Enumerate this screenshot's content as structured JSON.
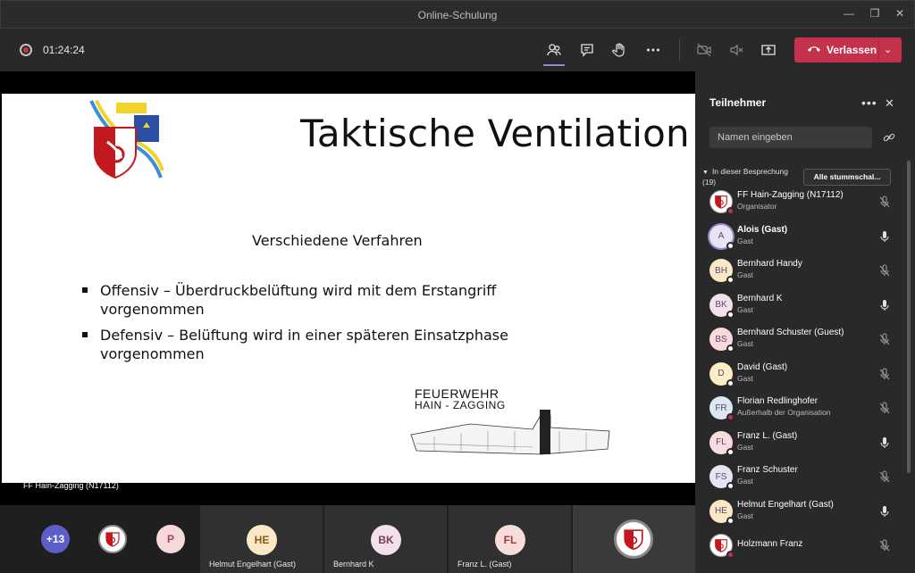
{
  "window": {
    "title": "Online-Schulung"
  },
  "toolbar": {
    "timer": "01:24:24",
    "leave_label": "Verlassen"
  },
  "slide": {
    "title": "Taktische Ventilation",
    "subtitle": "Verschiedene Verfahren",
    "bullets": [
      "Offensiv – Überdruckbelüftung wird mit dem Erstangriff vorgenommen",
      "Defensiv – Belüftung wird in einer späteren Einsatzphase vorgenommen"
    ],
    "logo_text_1": "FEUERWEHR",
    "logo_text_2": "HAIN - ZAGGING"
  },
  "stage": {
    "presenter_label": "FF Hain-Zagging (N17112)"
  },
  "strip": {
    "overflow": "+13",
    "tiles": [
      {
        "initials": "P",
        "name": ""
      },
      {
        "initials": "HE",
        "name": "Helmut Engelhart (Gast)"
      },
      {
        "initials": "BK",
        "name": "Bernhard K"
      },
      {
        "initials": "FL",
        "name": "Franz L. (Gast)"
      }
    ]
  },
  "panel": {
    "title": "Teilnehmer",
    "search_placeholder": "Namen eingeben",
    "section_label": "In dieser Besprechung (19)",
    "mute_all": "Alle stummschal...",
    "participants": [
      {
        "initials": "",
        "name": "FF Hain-Zagging (N17112)",
        "role": "Organisator",
        "avatar": "logo",
        "status": "red",
        "mic": "muted",
        "bold": false
      },
      {
        "initials": "A",
        "name": "Alois (Gast)",
        "role": "Gast",
        "avatar": "#e9e4f5",
        "status": "white",
        "mic": "on",
        "bold": true
      },
      {
        "initials": "BH",
        "name": "Bernhard Handy",
        "role": "Gast",
        "avatar": "#fbe8c7",
        "status": "white",
        "mic": "muted",
        "bold": false
      },
      {
        "initials": "BK",
        "name": "Bernhard K",
        "role": "Gast",
        "avatar": "#f2e0ea",
        "status": "white",
        "mic": "on",
        "bold": false
      },
      {
        "initials": "BS",
        "name": "Bernhard Schuster (Guest)",
        "role": "Gast",
        "avatar": "#f9d9d9",
        "status": "white",
        "mic": "muted",
        "bold": false
      },
      {
        "initials": "D",
        "name": "David (Gast)",
        "role": "Gast",
        "avatar": "#fbedc4",
        "status": "white",
        "mic": "muted",
        "bold": false
      },
      {
        "initials": "FR",
        "name": "Florian Redlinghofer",
        "role": "Außerhalb der Organisation",
        "avatar": "#dde7f1",
        "status": "red",
        "mic": "muted",
        "bold": false
      },
      {
        "initials": "FL",
        "name": "Franz L. (Gast)",
        "role": "Gast",
        "avatar": "#f7dcdc",
        "status": "white",
        "mic": "on",
        "bold": false
      },
      {
        "initials": "FS",
        "name": "Franz Schuster",
        "role": "Gast",
        "avatar": "#e4e4f4",
        "status": "white",
        "mic": "muted",
        "bold": false
      },
      {
        "initials": "HE",
        "name": "Helmut Engelhart (Gast)",
        "role": "Gast",
        "avatar": "#fbe8c7",
        "status": "white",
        "mic": "on",
        "bold": false
      },
      {
        "initials": "",
        "name": "Holzmann Franz",
        "role": "",
        "avatar": "logo",
        "status": "red",
        "mic": "muted",
        "bold": false
      }
    ]
  },
  "colors": {
    "accent": "#5b5fc7",
    "leave": "#c4314b",
    "background": "#1f1f1f",
    "panel": "#292929"
  }
}
